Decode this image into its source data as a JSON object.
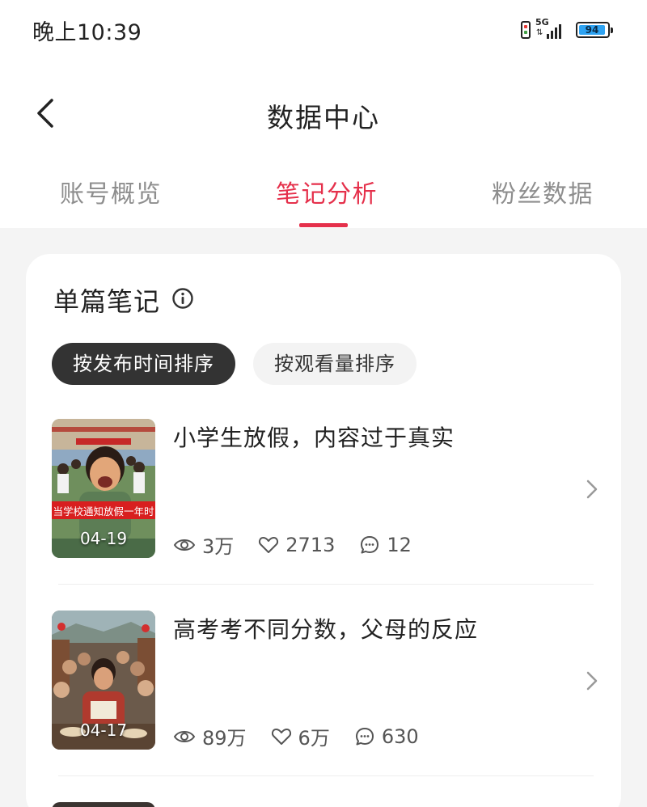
{
  "status_bar": {
    "time": "晚上10:39",
    "network": "5G",
    "battery": "94"
  },
  "header": {
    "title": "数据中心",
    "tabs": [
      {
        "label": "账号概览",
        "active": false
      },
      {
        "label": "笔记分析",
        "active": true
      },
      {
        "label": "粉丝数据",
        "active": false
      }
    ]
  },
  "section": {
    "title": "单篇笔记",
    "sort_options": [
      {
        "label": "按发布时间排序",
        "active": true
      },
      {
        "label": "按观看量排序",
        "active": false
      }
    ]
  },
  "notes": [
    {
      "title": "小学生放假，内容过于真实",
      "date": "04-19",
      "thumb_caption": "当学校通知放假一年时",
      "views": "3万",
      "likes": "2713",
      "comments": "12"
    },
    {
      "title": "高考考不同分数，父母的反应",
      "date": "04-17",
      "views": "89万",
      "likes": "6万",
      "comments": "630"
    }
  ],
  "colors": {
    "accent": "#e5304b",
    "active_chip": "#333333",
    "background": "#f4f4f4"
  }
}
